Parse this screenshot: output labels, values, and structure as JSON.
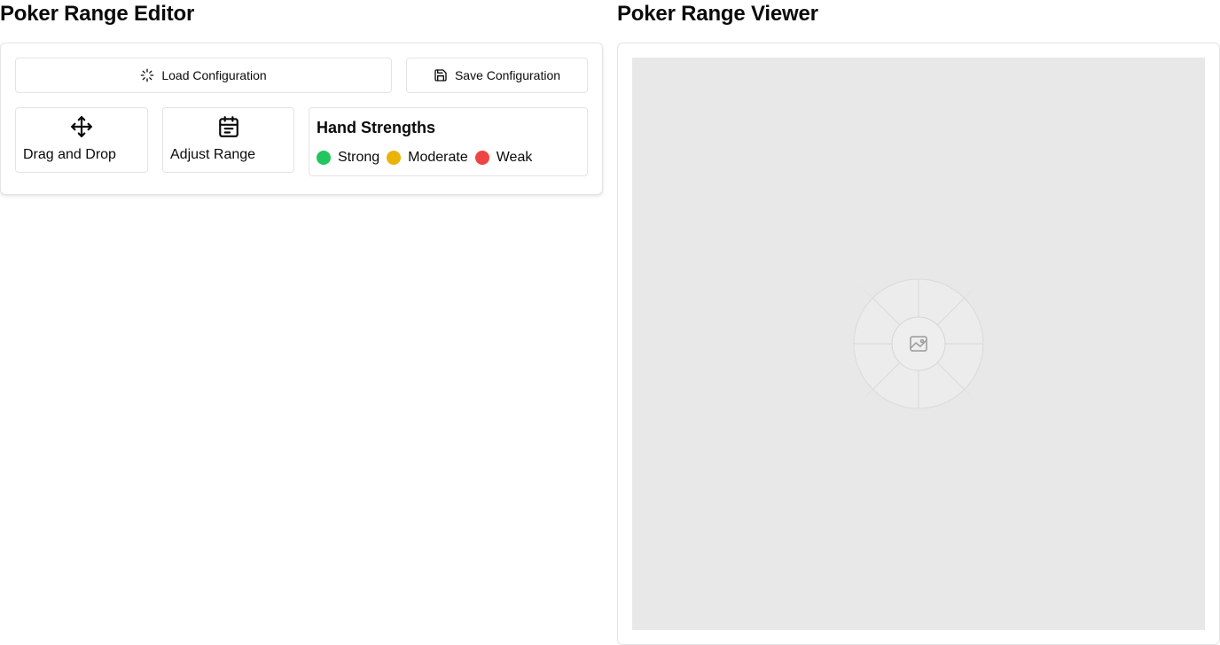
{
  "editor": {
    "title": "Poker Range Editor",
    "load_label": "Load Configuration",
    "save_label": "Save Configuration",
    "tools": [
      {
        "label": "Drag and Drop",
        "icon": "move-icon"
      },
      {
        "label": "Adjust Range",
        "icon": "calendar-icon"
      }
    ],
    "legend": {
      "title": "Hand Strengths",
      "items": [
        {
          "label": "Strong",
          "color": "#22c55e"
        },
        {
          "label": "Moderate",
          "color": "#eab308"
        },
        {
          "label": "Weak",
          "color": "#ef4444"
        }
      ]
    }
  },
  "viewer": {
    "title": "Poker Range Viewer",
    "placeholder_icon": "image-icon"
  }
}
